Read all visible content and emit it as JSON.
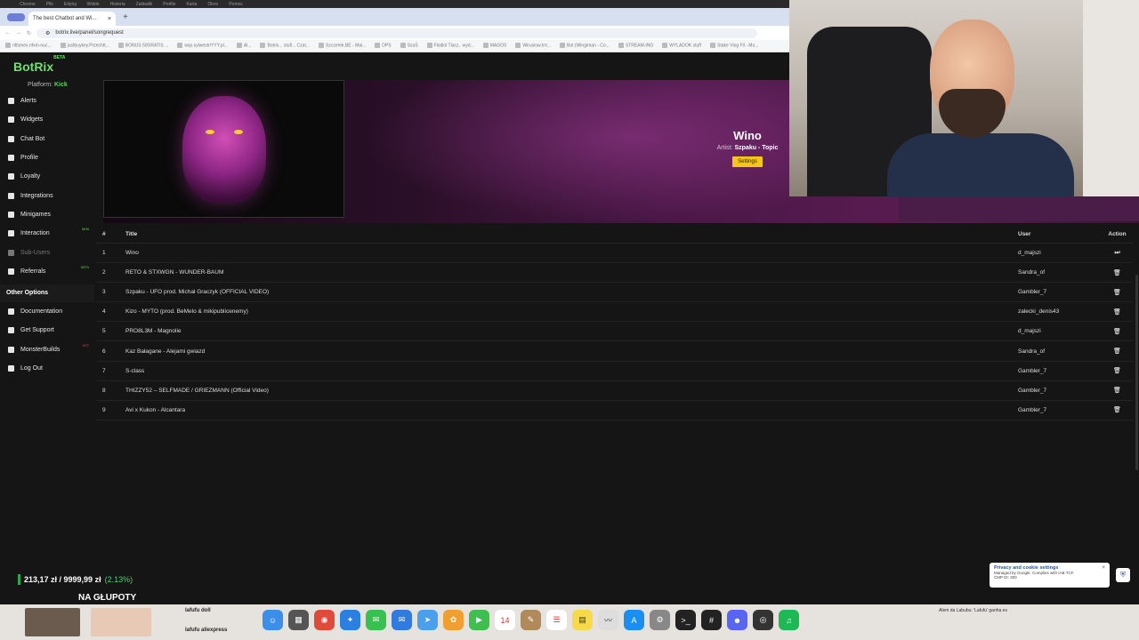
{
  "browser": {
    "menubar": [
      "Chrome",
      "Plik",
      "Edytuj",
      "Widok",
      "Historia",
      "Zakładki",
      "Profile",
      "Karta",
      "Okno",
      "Pomoc"
    ],
    "active_tab": "The best Chatbot and Wi...",
    "url": "botrix.live/panel/songrequest",
    "bookmarks": [
      "nftsmex.nfxm-nuc...",
      "justbuykey.Przechtt...",
      "BONUS 50GRATIS ...",
      "wsp.sylwestr/YYY.pl...",
      "Al...",
      "Botrix... stufi... Czat...",
      "Szczerek.BE - Mai...",
      "DPS",
      "SzaŚ",
      "Flodkit Tlacz.. wyd...",
      "MAGOS",
      "Wirusiow.trrr...",
      "Bot (Wingiman - Co...",
      "STREAM-ING",
      "WYLADOK stuff",
      "Stake Vlog Fil - Mo..."
    ]
  },
  "brand": {
    "name": "BotRix",
    "beta": "BETA"
  },
  "platform": {
    "label": "Platform:",
    "value": "Kick"
  },
  "sidebar": {
    "items": [
      {
        "label": "Alerts",
        "icon": "bell-icon",
        "badge": ""
      },
      {
        "label": "Widgets",
        "icon": "grid-icon",
        "badge": ""
      },
      {
        "label": "Chat Bot",
        "icon": "chat-icon",
        "badge": ""
      },
      {
        "label": "Profile",
        "icon": "user-icon",
        "badge": ""
      },
      {
        "label": "Loyalty",
        "icon": "trophy-icon",
        "badge": ""
      },
      {
        "label": "Integrations",
        "icon": "puzzle-icon",
        "badge": ""
      },
      {
        "label": "Minigames",
        "icon": "gamepad-icon",
        "badge": ""
      },
      {
        "label": "Interaction",
        "icon": "music-icon",
        "badge": "NEW"
      },
      {
        "label": "Sub-Users",
        "icon": "users-icon",
        "badge": ""
      },
      {
        "label": "Referrals",
        "icon": "handshake-icon",
        "badge": "BETA"
      }
    ],
    "other_title": "Other Options",
    "other_items": [
      {
        "label": "Documentation",
        "icon": "doc-icon",
        "badge": ""
      },
      {
        "label": "Get Support",
        "icon": "support-icon",
        "badge": ""
      },
      {
        "label": "MonsterBuilds",
        "icon": "monitor-icon",
        "badge": "HOT"
      },
      {
        "label": "Log Out",
        "icon": "logout-icon",
        "badge": ""
      }
    ]
  },
  "now_playing": {
    "title": "Wino",
    "artist_label": "Artist:",
    "artist": "Szpaku - Topic",
    "settings_label": "Settings"
  },
  "queue": {
    "headers": {
      "num": "#",
      "title": "Title",
      "user": "User",
      "action": "Action"
    },
    "rows": [
      {
        "num": "1",
        "title": "Wino",
        "user": "d_majszi",
        "action": "skip"
      },
      {
        "num": "2",
        "title": "RETO & STXWGN - WUNDER-BAUM",
        "user": "Sandra_of",
        "action": "delete"
      },
      {
        "num": "3",
        "title": "Szpaku - UFO prod. Michał Graczyk (OFFICIAL VIDEO)",
        "user": "Gambler_7",
        "action": "delete"
      },
      {
        "num": "4",
        "title": "Kizo - MYTO (prod. BeMelo & mikipublicenemy)",
        "user": "zalecki_denis43",
        "action": "delete"
      },
      {
        "num": "5",
        "title": "PRO8L3M - Magnolie",
        "user": "d_majszi",
        "action": "delete"
      },
      {
        "num": "6",
        "title": "Kaz Bałagane - Alejami gwiazd",
        "user": "Sandra_of",
        "action": "delete"
      },
      {
        "num": "7",
        "title": "S-class",
        "user": "Gambler_7",
        "action": "delete"
      },
      {
        "num": "8",
        "title": "THIZZY52 – SELFMADE / GRIEZMANN (Official Video)",
        "user": "Gambler_7",
        "action": "delete"
      },
      {
        "num": "9",
        "title": "Avi x Kukon - Alcantara",
        "user": "Gambler_7",
        "action": "delete"
      }
    ]
  },
  "overlay": {
    "price": "213,17 zł / 9999,99 zł",
    "change": "(2.13%)",
    "caption": "NA GŁUPOTY"
  },
  "cookie": {
    "title": "Privacy and cookie settings",
    "line1": "Managed by Google. Complies with IAB TCF.",
    "line2": "CMP ID: 300"
  },
  "dock": {
    "labels": [
      "lafufu doll",
      "lafufu aliexpress"
    ],
    "calendar_day": "14",
    "notification": "Alem da Labubu: 'Lafufu' ganha es"
  },
  "colors": {
    "accent_green": "#6ee06e",
    "settings_yellow": "#f5c518",
    "hero_purple": "#5a1c52"
  }
}
